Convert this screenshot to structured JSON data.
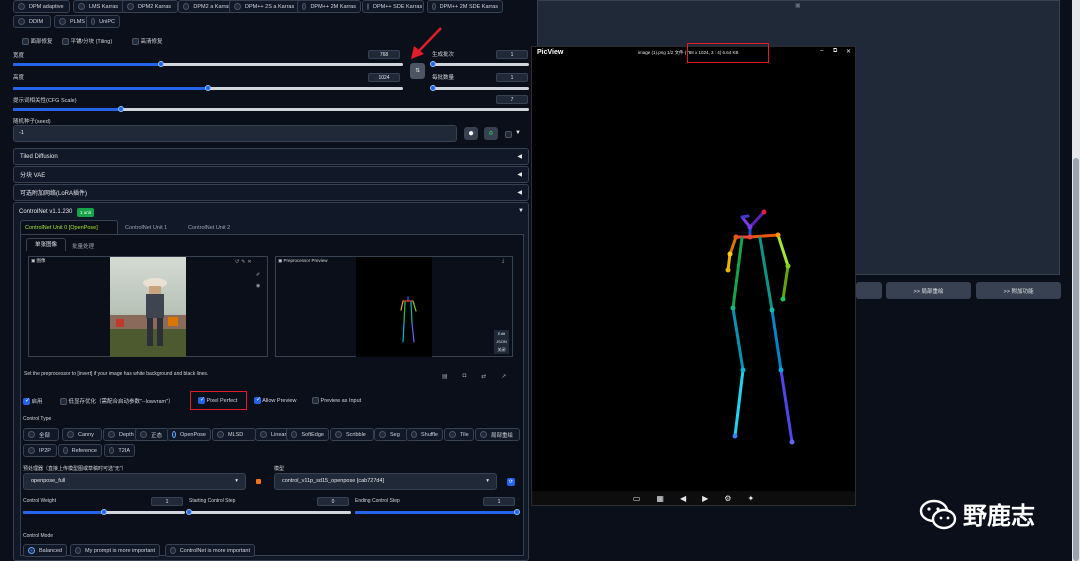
{
  "samplers": {
    "row1": [
      "DPM adaptive",
      "LMS Karras",
      "DPM2 Karras",
      "DPM2 a Karras",
      "DPM++ 2S a Karras",
      "DPM++ 2M Karras",
      "DPM++ SDE Karras",
      "DPM++ 2M SDE Karras"
    ],
    "row2": [
      "DDIM",
      "PLMS",
      "UniPC"
    ]
  },
  "options": {
    "face_restore": "面部修复",
    "tiling": "平铺/分块 (Tiling)",
    "hires": "高清修复"
  },
  "width": {
    "label": "宽度",
    "value": "768",
    "fraction": 0.38
  },
  "height": {
    "label": "高度",
    "value": "1024",
    "fraction": 0.5
  },
  "batch_count": {
    "label": "生成批次",
    "value": "1",
    "fraction": 0.0
  },
  "batch_size": {
    "label": "每批数量",
    "value": "1",
    "fraction": 0.0
  },
  "cfg": {
    "label": "提示词相关性(CFG Scale)",
    "value": "7",
    "fraction": 0.21
  },
  "seed": {
    "label": "随机种子(seed)",
    "value": "-1"
  },
  "accordions": {
    "tiled_diffusion": "Tiled Diffusion",
    "tiled_vae": "分块 VAE",
    "lora": "可选附加网络(LoRA插件)"
  },
  "controlnet": {
    "title": "ControlNet v1.1.230",
    "badge": "1 unit",
    "tabs": [
      "ControlNet Unit 0 [OpenPose]",
      "ControlNet Unit 1",
      "ControlNet Unit 2"
    ],
    "subtabs": [
      "单张图像",
      "批量处理"
    ],
    "image_label": "图像",
    "preview_label": "Preprocessor Preview",
    "preview_buttons": [
      "Edit",
      "JSON",
      "关闭"
    ],
    "hint": "Set the preprocessor to [invert] if your image has white background and black lines.",
    "enable": "启用",
    "lowvram": "低显存优化（需配合启动参数\"--lowvram\"）",
    "pixel_perfect": "Pixel Perfect",
    "allow_preview": "Allow Preview",
    "preview_input": "Preview as Input",
    "control_type_label": "Control Type",
    "control_types_row1": [
      "全部",
      "Canny",
      "Depth",
      "正态",
      "OpenPose",
      "MLSD",
      "Lineart",
      "SoftEdge",
      "Scribble",
      "Seg",
      "Shuffle",
      "Tile",
      "局部重绘"
    ],
    "control_types_row2": [
      "IP2P",
      "Reference",
      "T2IA"
    ],
    "selected_type": "OpenPose",
    "preprocessor_label": "预处理器（直接上传模型图或草稿时可选\"无\"）",
    "preprocessor": "openpose_full",
    "model_label": "模型",
    "model": "control_v11p_sd15_openpose [cab727d4]",
    "weight": {
      "label": "Control Weight",
      "value": "1",
      "fraction": 0.5
    },
    "start": {
      "label": "Starting Control Step",
      "value": "0",
      "fraction": 0.0
    },
    "end": {
      "label": "Ending Control Step",
      "value": "1",
      "fraction": 1.0
    },
    "mode_label": "Control Mode",
    "modes": [
      "Balanced",
      "My prompt is more important",
      "ControlNet is more important"
    ]
  },
  "picview": {
    "app": "PicView",
    "title": "image (1).png 1/2 文件 (768 x 1024, 3 : 4) 6.64 KB"
  },
  "right_buttons": [
    "",
    ">> 局部重绘",
    ">> 附加功能"
  ],
  "watermark": "野鹿志",
  "colors": {
    "accent": "#2563eb",
    "highlight": "#e11d2a",
    "tab_active": "#a3e635"
  }
}
